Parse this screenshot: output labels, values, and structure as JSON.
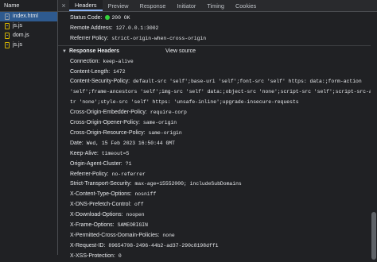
{
  "sidebar": {
    "header": "Name",
    "files": [
      {
        "name": "index.html",
        "type": "html",
        "selected": true
      },
      {
        "name": "js.js",
        "type": "js",
        "selected": false
      },
      {
        "name": "dom.js",
        "type": "js",
        "selected": false
      },
      {
        "name": "js.js",
        "type": "js",
        "selected": false
      }
    ]
  },
  "tabs": {
    "close": "×",
    "items": [
      "Headers",
      "Preview",
      "Response",
      "Initiator",
      "Timing",
      "Cookies"
    ],
    "active": "Headers"
  },
  "general": {
    "status_label": "Status Code:",
    "status_value": "200 OK",
    "status_color": "#35d43d",
    "remote_label": "Remote Address:",
    "remote_value": "127.0.0.1:3002",
    "referrer_label": "Referrer Policy:",
    "referrer_value": "strict-origin-when-cross-origin"
  },
  "response_section": {
    "title": "Response Headers",
    "view_source": "View source"
  },
  "headers": {
    "connection": {
      "name": "Connection:",
      "value": "keep-alive"
    },
    "content_length": {
      "name": "Content-Length:",
      "value": "1472"
    },
    "csp": {
      "name": "Content-Security-Policy:",
      "line1": "default-src 'self';base-uri 'self';font-src 'self' https: data:;form-action",
      "line2": "'self';frame-ancestors 'self';img-src 'self' data:;object-src 'none';script-src 'self';script-src-at",
      "line3": "tr 'none';style-src 'self' https: 'unsafe-inline';upgrade-insecure-requests"
    },
    "coep": {
      "name": "Cross-Origin-Embedder-Policy:",
      "value": "require-corp"
    },
    "coop": {
      "name": "Cross-Origin-Opener-Policy:",
      "value": "same-origin"
    },
    "corp": {
      "name": "Cross-Origin-Resource-Policy:",
      "value": "same-origin"
    },
    "date": {
      "name": "Date:",
      "value": "Wed, 15 Feb 2023 16:50:44 GMT"
    },
    "keep_alive": {
      "name": "Keep-Alive:",
      "value": "timeout=5"
    },
    "origin_agent_cluster": {
      "name": "Origin-Agent-Cluster:",
      "value": "?1"
    },
    "referrer_policy": {
      "name": "Referrer-Policy:",
      "value": "no-referrer"
    },
    "hsts": {
      "name": "Strict-Transport-Security:",
      "value": "max-age=15552000; includeSubDomains"
    },
    "xcto": {
      "name": "X-Content-Type-Options:",
      "value": "nosniff"
    },
    "xdns": {
      "name": "X-DNS-Prefetch-Control:",
      "value": "off"
    },
    "xdownload": {
      "name": "X-Download-Options:",
      "value": "noopen"
    },
    "xframe": {
      "name": "X-Frame-Options:",
      "value": "SAMEORIGIN"
    },
    "xpcdp": {
      "name": "X-Permitted-Cross-Domain-Policies:",
      "value": "none"
    },
    "xrequest": {
      "name": "X-Request-ID:",
      "value": "89654708-2496-44b2-ad37-290c8198dff1"
    },
    "xxss": {
      "name": "X-XSS-Protection:",
      "value": "0"
    }
  }
}
